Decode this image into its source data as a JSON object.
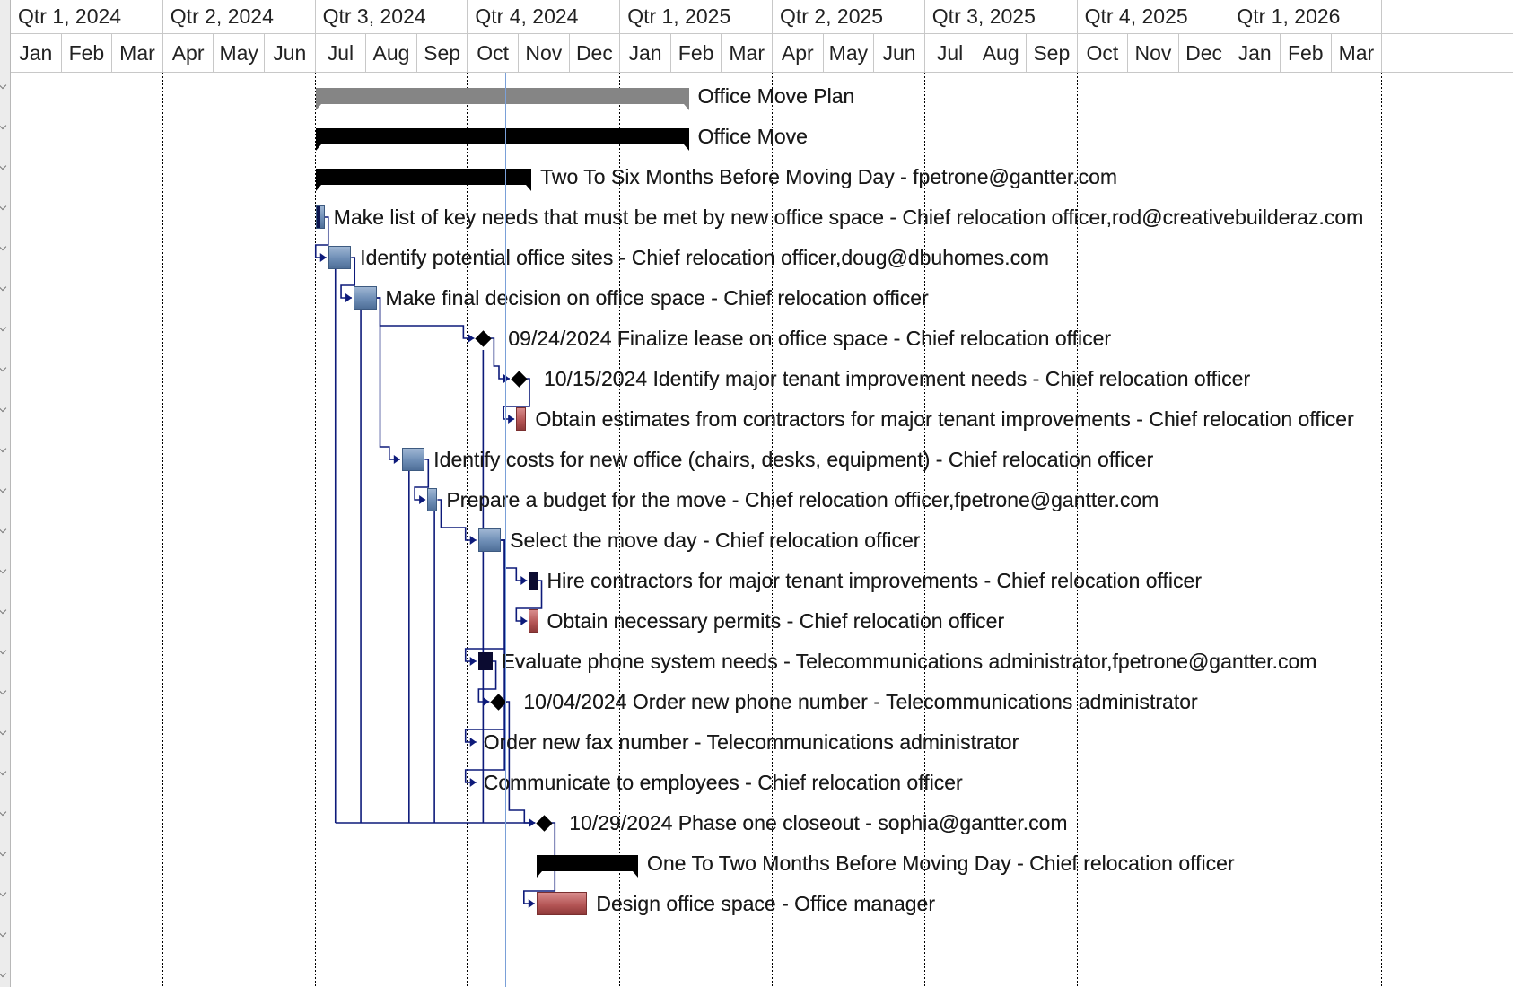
{
  "timescale": {
    "quarters": [
      "Qtr 1, 2024",
      "Qtr 2, 2024",
      "Qtr 3, 2024",
      "Qtr 4, 2024",
      "Qtr 1, 2025",
      "Qtr 2, 2025",
      "Qtr 3, 2025",
      "Qtr 4, 2025",
      "Qtr 1, 2026"
    ],
    "months": [
      "Jan",
      "Feb",
      "Mar",
      "Apr",
      "May",
      "Jun",
      "Jul",
      "Aug",
      "Sep",
      "Oct",
      "Nov",
      "Dec",
      "Jan",
      "Feb",
      "Mar",
      "Apr",
      "May",
      "Jun",
      "Jul",
      "Aug",
      "Sep",
      "Oct",
      "Nov",
      "Dec",
      "Jan",
      "Feb",
      "Mar"
    ]
  },
  "colors": {
    "summary_gray": "#858585",
    "summary_black": "#000000",
    "task_blue": "#6d8db5",
    "task_red": "#b25353",
    "link_line": "#0d1a7a",
    "today_line": "#7aa0d8",
    "grid_line": "#000000"
  },
  "tasks": [
    {
      "id": "t1",
      "type": "summary-gray",
      "start": 6.0,
      "end": 13.35,
      "label": "Office Move Plan"
    },
    {
      "id": "t2",
      "type": "summary-black",
      "start": 6.0,
      "end": 13.35,
      "label": "Office Move"
    },
    {
      "id": "t3",
      "type": "summary-black",
      "start": 6.0,
      "end": 10.25,
      "label": "Two To Six Months Before Moving Day - fpetrone@gantter.com"
    },
    {
      "id": "t4",
      "type": "task-blue",
      "start": 6.0,
      "end": 6.18,
      "progress": 0.5,
      "label": "Make list of key needs that must be met by new office space - Chief relocation officer,rod@creativebuilderaz.com"
    },
    {
      "id": "t5",
      "type": "task-blue",
      "start": 6.25,
      "end": 6.7,
      "label": "Identify potential office sites - Chief relocation officer,doug@dbuhomes.com"
    },
    {
      "id": "t6",
      "type": "task-blue",
      "start": 6.75,
      "end": 7.2,
      "label": "Make final decision on office space - Chief relocation officer"
    },
    {
      "id": "t7",
      "type": "milestone",
      "start": 9.3,
      "label": "09/24/2024 Finalize lease on office space - Chief relocation officer"
    },
    {
      "id": "t8",
      "type": "milestone",
      "start": 10.0,
      "label": "10/15/2024 Identify major tenant improvement needs - Chief relocation officer"
    },
    {
      "id": "t9",
      "type": "task-red",
      "start": 9.95,
      "end": 10.15,
      "label": "Obtain estimates from contractors for major tenant improvements - Chief relocation officer"
    },
    {
      "id": "t10",
      "type": "task-blue",
      "start": 7.7,
      "end": 8.15,
      "label": "Identify costs for new office (chairs, desks, equipment) - Chief relocation officer"
    },
    {
      "id": "t11",
      "type": "task-blue",
      "start": 8.2,
      "end": 8.4,
      "label": "Prepare a budget for the move - Chief relocation officer,fpetrone@gantter.com"
    },
    {
      "id": "t12",
      "type": "task-blue",
      "start": 9.2,
      "end": 9.65,
      "label": "Select the move day - Chief relocation officer"
    },
    {
      "id": "t13",
      "type": "task-black",
      "start": 10.2,
      "end": 10.38,
      "label": "Hire contractors for major tenant improvements - Chief relocation officer"
    },
    {
      "id": "t14",
      "type": "task-red",
      "start": 10.2,
      "end": 10.38,
      "label": "Obtain necessary permits - Chief relocation officer"
    },
    {
      "id": "t15",
      "type": "task-black",
      "start": 9.2,
      "end": 9.48,
      "label": "Evaluate phone system needs - Telecommunications administrator,fpetrone@gantter.com"
    },
    {
      "id": "t16",
      "type": "milestone",
      "start": 9.6,
      "label": "10/04/2024 Order new phone number - Telecommunications administrator"
    },
    {
      "id": "t17",
      "type": "none",
      "start": 9.2,
      "label": "Order new fax number - Telecommunications administrator"
    },
    {
      "id": "t18",
      "type": "none",
      "start": 9.2,
      "label": "Communicate to employees - Chief relocation officer"
    },
    {
      "id": "t19",
      "type": "milestone",
      "start": 10.5,
      "label": "10/29/2024 Phase one closeout - sophia@gantter.com"
    },
    {
      "id": "t20",
      "type": "summary-black",
      "start": 10.35,
      "end": 12.35,
      "label": "One To Two Months Before Moving Day - Chief relocation officer"
    },
    {
      "id": "t21",
      "type": "task-red",
      "start": 10.35,
      "end": 11.35,
      "label": "Design office space - Office manager"
    }
  ]
}
